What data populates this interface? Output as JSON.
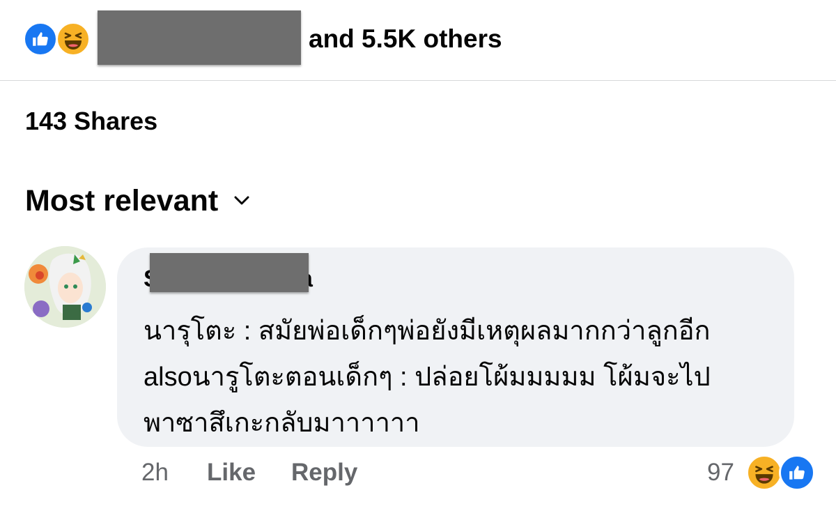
{
  "reactions_summary": {
    "icons": [
      "like-icon",
      "haha-icon"
    ],
    "text": "and 5.5K others"
  },
  "shares": "143 Shares",
  "sort": {
    "label": "Most relevant",
    "icon": "chevron-down-icon"
  },
  "comment": {
    "author_first_char": "S",
    "author_last_char": "a",
    "lines": [
      "นารุโตะ : สมัยพ่อเด็กๆพ่อยังมีเหตุผลมากกว่าลูกอีก",
      "alsoนารูโตะตอนเด็กๆ : ปล่อยโผ้มมมมม โผ้มจะไป",
      "พาซาสึเกะกลับมาาาาาา"
    ],
    "time": "2h",
    "like_label": "Like",
    "reply_label": "Reply",
    "reaction_count": "97",
    "reaction_icons": [
      "haha-icon",
      "like-icon"
    ]
  },
  "colors": {
    "like_blue": "#1877f2",
    "haha_yellow": "#f7b125",
    "bubble_bg": "#f0f2f5",
    "meta_grey": "#65676b",
    "redaction_grey": "#6e6e6e"
  }
}
